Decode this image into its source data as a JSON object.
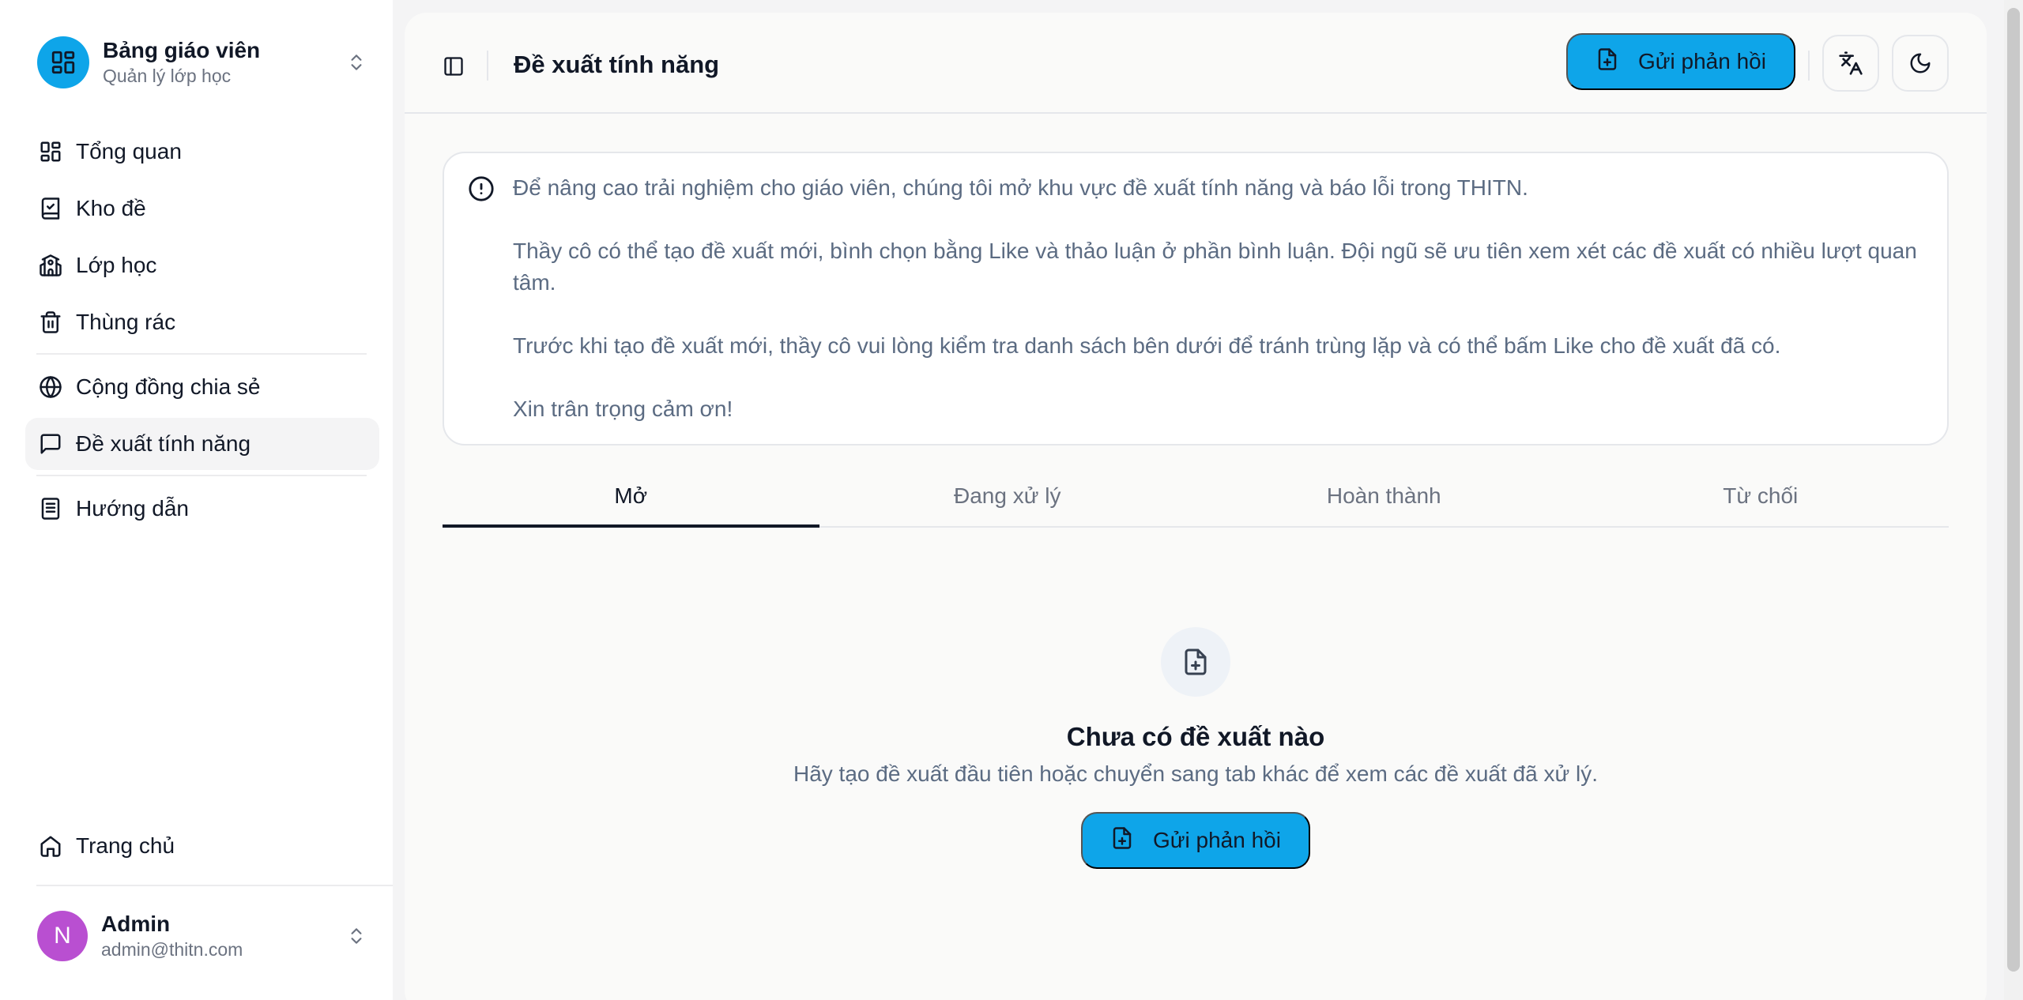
{
  "sidebar": {
    "brand": {
      "title": "Bảng giáo viên",
      "subtitle": "Quản lý lớp học"
    },
    "items": [
      {
        "label": "Tổng quan",
        "icon": "layout-grid-icon"
      },
      {
        "label": "Kho đề",
        "icon": "book-check-icon"
      },
      {
        "label": "Lớp học",
        "icon": "school-icon"
      },
      {
        "label": "Thùng rác",
        "icon": "trash-icon"
      },
      {
        "label": "Cộng đồng chia sẻ",
        "icon": "globe-icon"
      },
      {
        "label": "Đề xuất tính năng",
        "icon": "message-square-icon"
      },
      {
        "label": "Hướng dẫn",
        "icon": "notebook-icon"
      }
    ],
    "home": {
      "label": "Trang chủ",
      "icon": "home-icon"
    },
    "user": {
      "initial": "N",
      "name": "Admin",
      "email": "admin@thitn.com"
    }
  },
  "header": {
    "title": "Đề xuất tính năng",
    "feedback_button": "Gửi phản hồi"
  },
  "notice": {
    "paragraphs": [
      "Để nâng cao trải nghiệm cho giáo viên, chúng tôi mở khu vực đề xuất tính năng và báo lỗi trong THITN.",
      "Thầy cô có thể tạo đề xuất mới, bình chọn bằng Like và thảo luận ở phần bình luận. Đội ngũ sẽ ưu tiên xem xét các đề xuất có nhiều lượt quan tâm.",
      "Trước khi tạo đề xuất mới, thầy cô vui lòng kiểm tra danh sách bên dưới để tránh trùng lặp và có thể bấm Like cho đề xuất đã có.",
      "Xin trân trọng cảm ơn!"
    ]
  },
  "tabs": [
    {
      "label": "Mở",
      "active": true
    },
    {
      "label": "Đang xử lý",
      "active": false
    },
    {
      "label": "Hoàn thành",
      "active": false
    },
    {
      "label": "Từ chối",
      "active": false
    }
  ],
  "empty_state": {
    "title": "Chưa có đề xuất nào",
    "description": "Hãy tạo đề xuất đầu tiên hoặc chuyển sang tab khác để xem các đề xuất đã xử lý.",
    "button": "Gửi phản hồi"
  },
  "colors": {
    "accent": "#0ea5e9",
    "avatar": "#b94fd1"
  }
}
